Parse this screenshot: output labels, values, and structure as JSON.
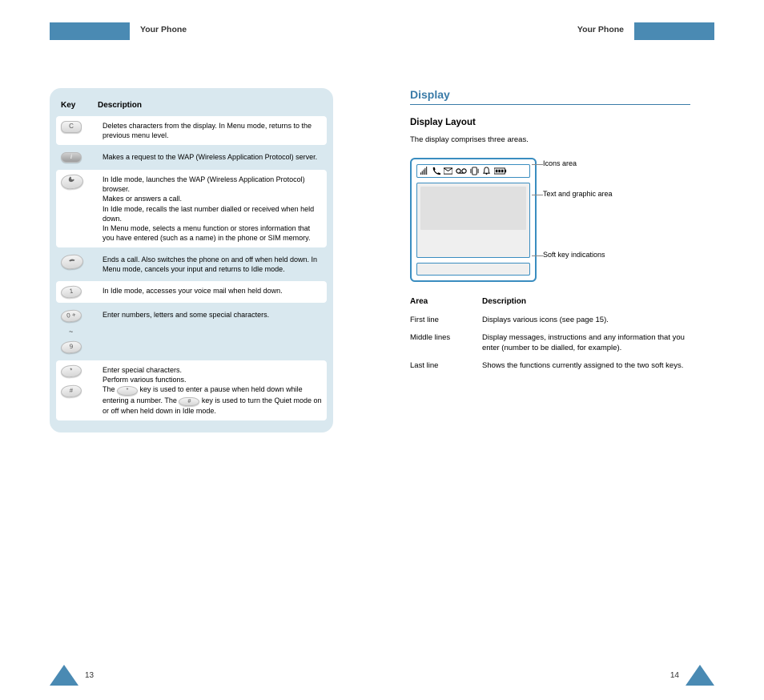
{
  "bars": {
    "left_label": "Your Phone",
    "right_label": "Your Phone"
  },
  "table": {
    "header_key": "Key",
    "header_desc": "Description",
    "rows": [
      {
        "key_glyph": "C",
        "desc_plain": "Deletes characters from the display. In Menu mode, returns to the previous menu level."
      },
      {
        "key_glyph": "i",
        "desc_plain": "Makes a request to the WAP (Wireless Application Protocol) server."
      },
      {
        "key_glyph": "call",
        "desc_html": "In Idle mode, launches the WAP (Wireless Application Protocol) browser.<br>Makes or answers a call.<br>In Idle mode, recalls the last number dialled or received when held down.<br>In Menu mode, selects a menu function or stores information that you have entered (such as a name) in the phone or SIM memory."
      },
      {
        "key_glyph": "end",
        "desc_plain": "Ends a call. Also switches the phone on and off when held down. In Menu mode, cancels your input and returns to Idle mode."
      },
      {
        "key_glyph": "1",
        "desc_plain": "In Idle mode, accesses your voice mail when held down."
      },
      {
        "key_glyphs": [
          "0 +",
          "9"
        ],
        "head": "~",
        "desc_plain": "Enter numbers, letters and some special characters."
      },
      {
        "key_glyphs": [
          "*",
          "#"
        ],
        "desc_html": "Enter special characters. Perform various functions.<br>The &nbsp;&nbsp;&nbsp;&nbsp; key is used to enter a pause when held down while entering a number. The &nbsp;&nbsp;&nbsp;&nbsp; key is used to turn the Quiet mode on or off when held down in Idle mode.",
        "inline_keys": [
          "*",
          "#"
        ]
      }
    ]
  },
  "right": {
    "title": "Display",
    "layout_head": "Display Layout",
    "layout_intro": "The display comprises three areas.",
    "callouts": {
      "icons": "Icons area",
      "text": "Text and graphic area",
      "soft": "Soft key indications"
    },
    "status_icons": [
      "signal",
      "call",
      "sms",
      "vm",
      "vib",
      "alarm",
      "batt"
    ],
    "areas": [
      {
        "name": "Area",
        "desc_head": "Description"
      },
      {
        "name": "First line",
        "desc": "Displays various icons (see page 15)."
      },
      {
        "name": "Middle lines",
        "desc": "Display messages, instructions and any information that you enter (number to be dialled, for example)."
      },
      {
        "name": "Last line",
        "desc": "Shows the functions currently assigned to the two soft keys."
      }
    ]
  },
  "pages": {
    "left": "13",
    "right": "14"
  }
}
